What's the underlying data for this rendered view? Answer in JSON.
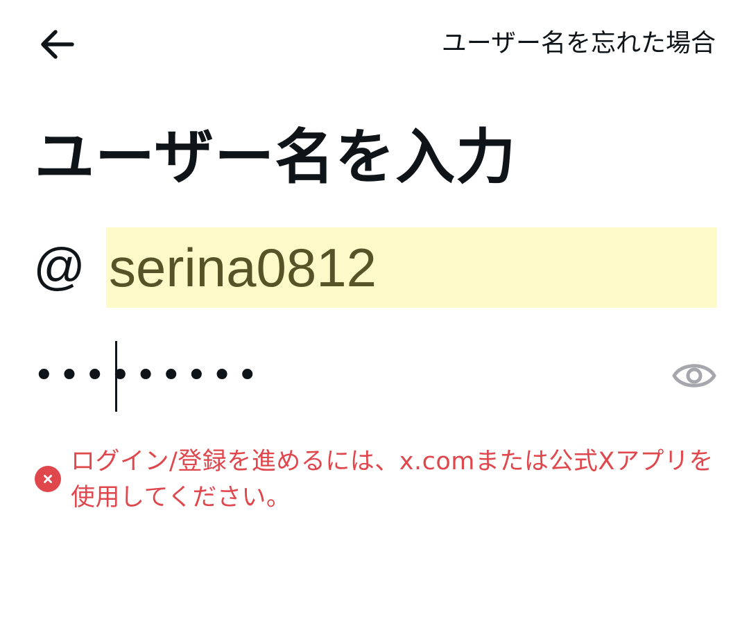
{
  "header": {
    "back_icon": "arrow-left-icon",
    "forgot_link": "ユーザー名を忘れた場合"
  },
  "title": "ユーザー名を入力",
  "username": {
    "prefix": "@",
    "value": "serina0812",
    "highlight_color": "#fdf9c8"
  },
  "password": {
    "value": "•••••••••",
    "toggle_icon": "eye-icon"
  },
  "error": {
    "icon": "error-x-circle-icon",
    "message": "ログイン/登録を進めるには、x.comまたは公式Xアプリを使用してください。",
    "color": "#e0474d"
  }
}
